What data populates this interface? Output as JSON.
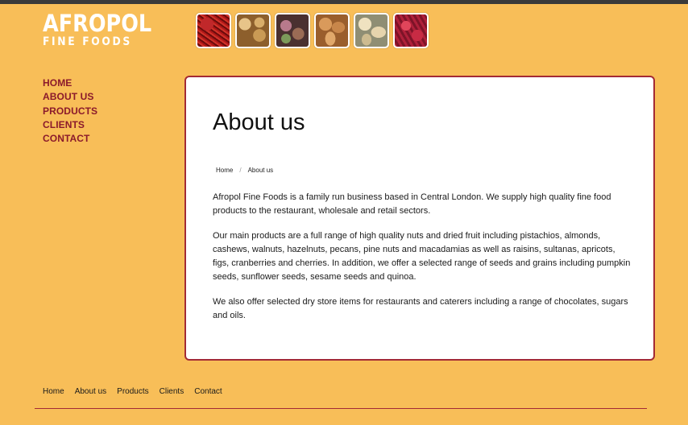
{
  "brand": {
    "name_line1": "AFROPOL",
    "name_line2": "FINE FOODS"
  },
  "header_images": [
    {
      "icon": "saffron-image"
    },
    {
      "icon": "walnuts-image"
    },
    {
      "icon": "pistachios-image"
    },
    {
      "icon": "almonds-image"
    },
    {
      "icon": "cashews-image"
    },
    {
      "icon": "cranberries-image"
    }
  ],
  "nav": {
    "items": [
      {
        "label": "HOME"
      },
      {
        "label": "ABOUT US"
      },
      {
        "label": "PRODUCTS"
      },
      {
        "label": "CLIENTS"
      },
      {
        "label": "CONTACT"
      }
    ]
  },
  "main": {
    "title": "About us",
    "breadcrumb": {
      "home": "Home",
      "separator": "/",
      "current": "About us"
    },
    "paragraphs": [
      "Afropol Fine Foods is a family run business based in Central London. We supply high quality fine food products to the restaurant, wholesale and retail sectors.",
      "Our main products are a full range of high quality nuts and dried fruit including pistachios, almonds, cashews, walnuts, hazelnuts, pecans, pine nuts and macadamias as well as raisins, sultanas, apricots, figs, cranberries and cherries. In addition, we offer a selected range of seeds and grains including pumpkin seeds, sunflower seeds, sesame seeds and quinoa.",
      "We also offer selected dry store items for restaurants and caterers including a range of chocolates, sugars and oils."
    ]
  },
  "footer": {
    "links": [
      {
        "label": "Home"
      },
      {
        "label": "About us"
      },
      {
        "label": "Products"
      },
      {
        "label": "Clients"
      },
      {
        "label": "Contact"
      }
    ]
  },
  "colors": {
    "background": "#f8be58",
    "accent": "#8b1a2b",
    "card_border": "#a32a35"
  }
}
